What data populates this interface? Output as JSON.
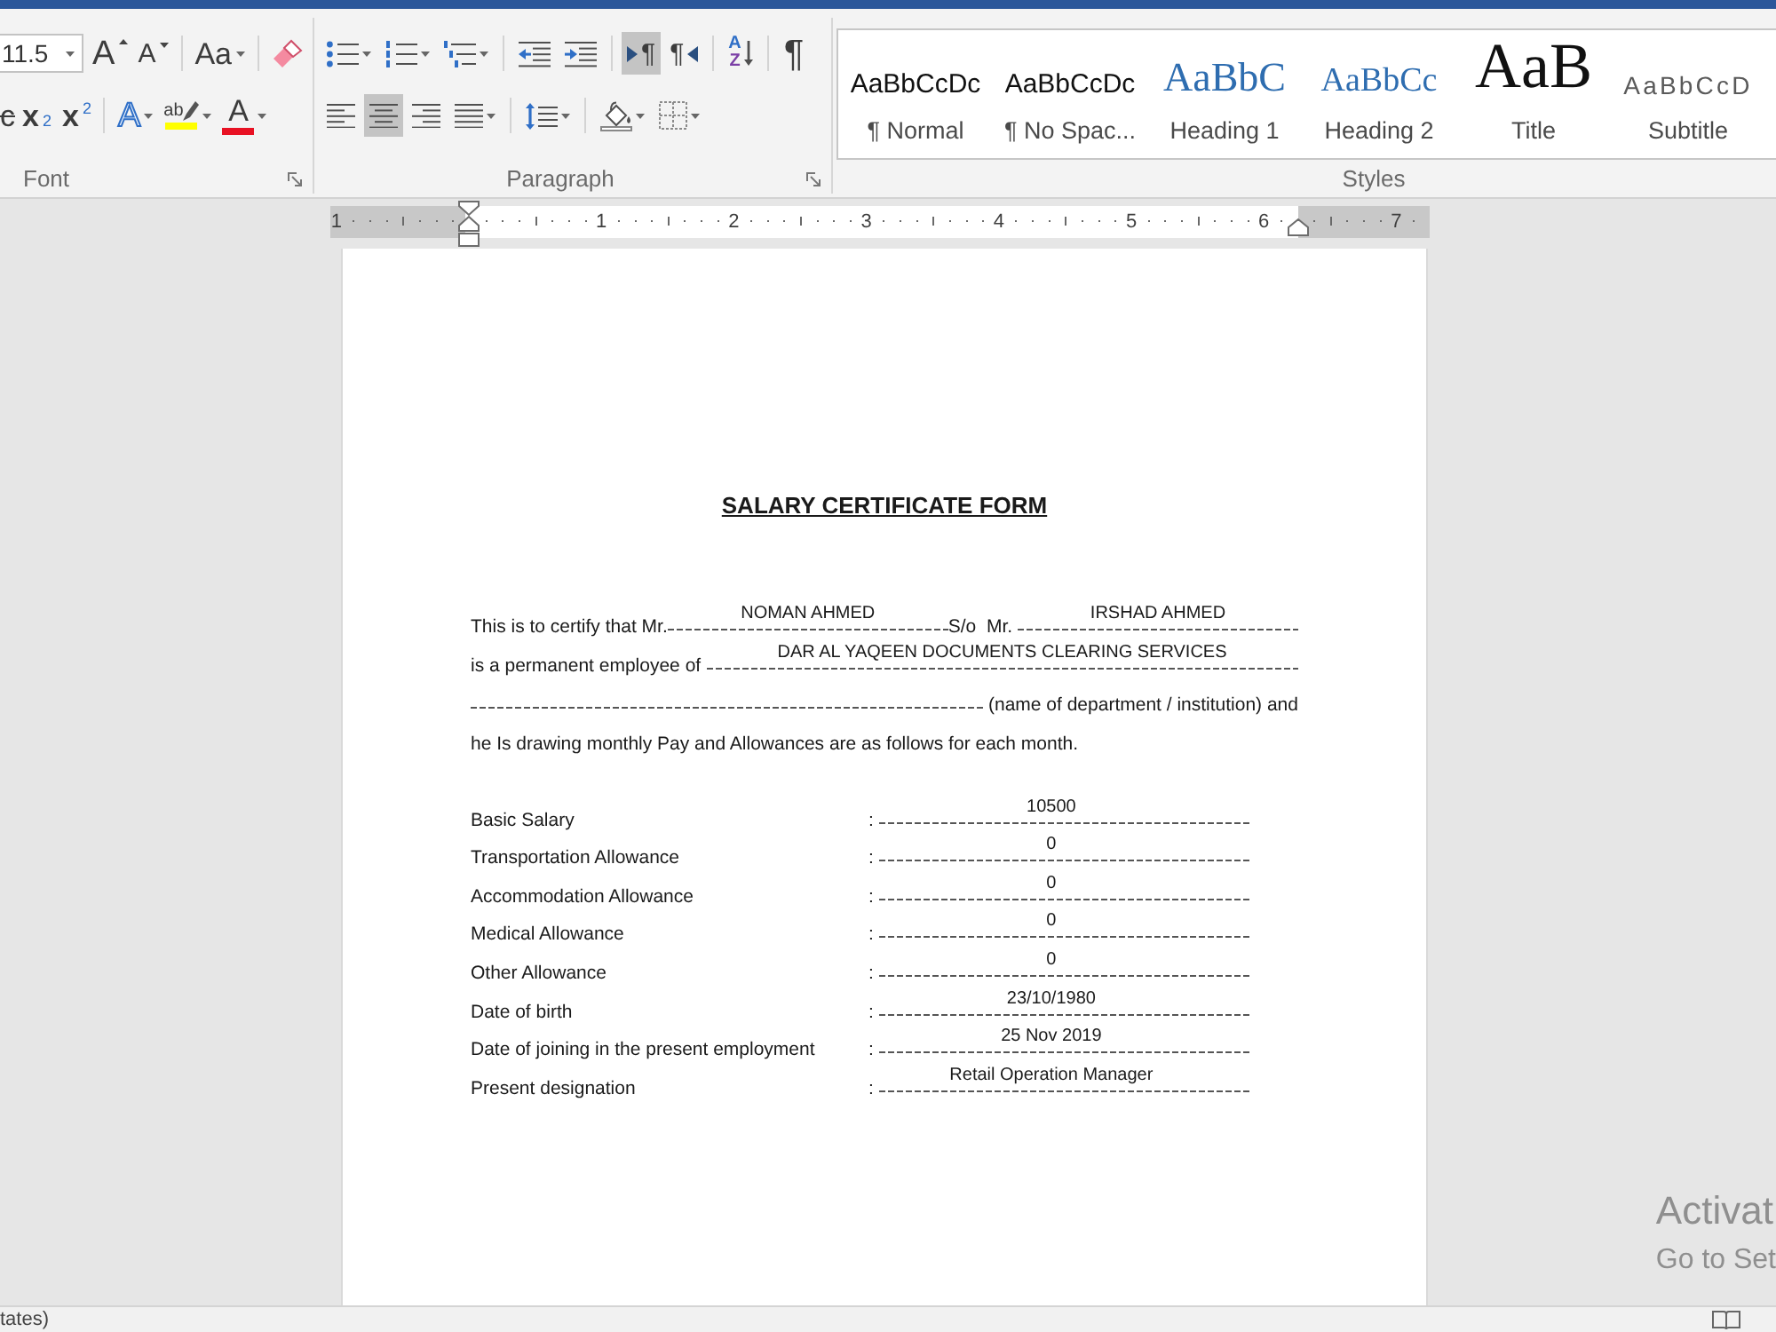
{
  "ribbon": {
    "font_group": {
      "label": "Font",
      "launcher": true,
      "size": "11.5",
      "rows": [
        {
          "clusters": [
            {
              "buttons": [
                {
                  "kind": "grow",
                  "glyph": "A",
                  "menu": false,
                  "selected": false
                },
                {
                  "kind": "shrink",
                  "glyph": "A",
                  "menu": false,
                  "selected": false
                }
              ]
            },
            {
              "buttons": [
                {
                  "kind": "change_case",
                  "glyph": "Aa",
                  "menu": true,
                  "selected": false
                }
              ]
            },
            {
              "buttons": [
                {
                  "kind": "clear_formatting",
                  "menu": false,
                  "selected": false
                }
              ]
            }
          ]
        },
        {
          "clusters": [
            {
              "buttons": [
                {
                  "kind": "strikethrough",
                  "glyph": "c",
                  "menu": false,
                  "selected": false
                },
                {
                  "kind": "subscript",
                  "glyph": "x",
                  "index": "2",
                  "menu": false,
                  "selected": false
                },
                {
                  "kind": "superscript",
                  "glyph": "x",
                  "index": "2",
                  "menu": false,
                  "selected": false
                }
              ]
            },
            {
              "buttons": [
                {
                  "kind": "text_effects",
                  "glyph": "A",
                  "menu": true,
                  "selected": false
                },
                {
                  "kind": "highlight",
                  "glyph": "ab",
                  "color": "#ffff00",
                  "menu": true,
                  "selected": false
                },
                {
                  "kind": "font_color",
                  "glyph": "A",
                  "color": "#e81123",
                  "menu": true,
                  "selected": false
                }
              ]
            }
          ]
        }
      ]
    },
    "paragraph_group": {
      "label": "Paragraph",
      "launcher": true,
      "rows": [
        {
          "clusters": [
            {
              "buttons": [
                {
                  "kind": "bullets",
                  "menu": true,
                  "selected": false
                },
                {
                  "kind": "numbering",
                  "menu": true,
                  "selected": false
                },
                {
                  "kind": "multilevel",
                  "menu": true,
                  "selected": false
                }
              ]
            },
            {
              "buttons": [
                {
                  "kind": "decrease_indent",
                  "menu": false,
                  "selected": false
                },
                {
                  "kind": "increase_indent",
                  "menu": false,
                  "selected": false
                }
              ]
            },
            {
              "buttons": [
                {
                  "kind": "ltr",
                  "glyph": "¶",
                  "menu": false,
                  "selected": true
                },
                {
                  "kind": "rtl",
                  "glyph": "¶",
                  "menu": false,
                  "selected": false
                }
              ]
            },
            {
              "buttons": [
                {
                  "kind": "sort",
                  "glyph": "A",
                  "glyph_2": "Z",
                  "menu": false,
                  "selected": false
                }
              ]
            },
            {
              "buttons": [
                {
                  "kind": "show_marks",
                  "glyph": "¶",
                  "menu": false,
                  "selected": false
                }
              ]
            }
          ]
        },
        {
          "clusters": [
            {
              "buttons": [
                {
                  "kind": "align_left",
                  "menu": false,
                  "selected": false
                },
                {
                  "kind": "align_center",
                  "menu": false,
                  "selected": true
                },
                {
                  "kind": "align_right",
                  "menu": false,
                  "selected": false
                },
                {
                  "kind": "justify",
                  "menu": true,
                  "selected": false
                }
              ]
            },
            {
              "buttons": [
                {
                  "kind": "line_spacing",
                  "menu": true,
                  "selected": false
                }
              ]
            },
            {
              "buttons": [
                {
                  "kind": "shading",
                  "menu": true,
                  "selected": false
                },
                {
                  "kind": "borders",
                  "menu": true,
                  "selected": false
                }
              ]
            }
          ]
        }
      ]
    },
    "styles_group": {
      "label": "Styles",
      "styles": [
        {
          "kind": "normal",
          "sample": "AaBbCcDc",
          "name": "¶ Normal",
          "selected": false
        },
        {
          "kind": "no_spacing",
          "sample": "AaBbCcDc",
          "name": "¶ No Spac...",
          "selected": false
        },
        {
          "kind": "heading_1",
          "sample": "AaBbC",
          "name": "Heading 1",
          "selected": false
        },
        {
          "kind": "heading_2",
          "sample": "AaBbCc",
          "name": "Heading 2",
          "selected": false
        },
        {
          "kind": "title",
          "sample": "AaB",
          "name": "Title",
          "selected": false
        },
        {
          "kind": "subtitle",
          "sample": "AaBbCcD",
          "name": "Subtitle",
          "selected": false
        }
      ]
    }
  },
  "ruler": {
    "labels": [
      "1",
      "1",
      "2",
      "3",
      "4",
      "5",
      "6",
      "7"
    ]
  },
  "document": {
    "title": "SALARY CERTIFICATE FORM",
    "lines": [
      {
        "segments": [
          {
            "kind": "text",
            "text": "This is to certify that Mr."
          },
          {
            "kind": "blank",
            "value": "NOMAN AHMED"
          },
          {
            "kind": "text",
            "text": "S/o  Mr. "
          },
          {
            "kind": "blank",
            "value": "IRSHAD AHMED"
          }
        ]
      },
      {
        "segments": [
          {
            "kind": "text",
            "text": "is a permanent employee of "
          },
          {
            "kind": "blank",
            "value": "DAR AL YAQEEN DOCUMENTS CLEARING SERVICES"
          }
        ]
      },
      {
        "segments": [
          {
            "kind": "blank"
          },
          {
            "kind": "text",
            "text": " (name of department / institution) and"
          }
        ]
      },
      {
        "segments": [
          {
            "kind": "text",
            "text": "he Is drawing monthly Pay and Allowances are as follows for each month."
          }
        ]
      }
    ],
    "rows": [
      {
        "label": "Basic Salary",
        "colon": ":",
        "value": "10500"
      },
      {
        "label": "Transportation Allowance",
        "colon": ":",
        "value": "0"
      },
      {
        "label": "Accommodation Allowance",
        "colon": ":",
        "value": "0"
      },
      {
        "label": "Medical Allowance",
        "colon": ":",
        "value": "0"
      },
      {
        "label": "Other Allowance",
        "colon": ":",
        "value": "0"
      },
      {
        "label": "Date of birth",
        "colon": ":",
        "value": "23/10/1980"
      },
      {
        "label": "Date of joining in the present employment",
        "colon": ":",
        "value": "25 Nov 2019"
      },
      {
        "label": "Present designation",
        "colon": ":",
        "value": "Retail Operation Manager"
      }
    ]
  },
  "status_bar": {
    "text": "tates)"
  },
  "activation_notice": {
    "title": "Activat",
    "text": "Go to Set"
  }
}
